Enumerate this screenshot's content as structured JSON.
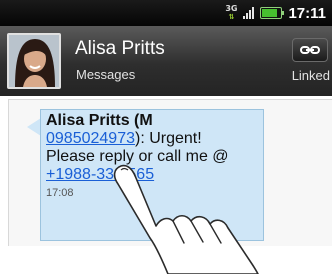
{
  "status_bar": {
    "network": "3G",
    "time": "17:11"
  },
  "header": {
    "contact_name": "Alisa Pritts",
    "subtitle": "Messages",
    "link_status": "Linked"
  },
  "message": {
    "sender_prefix": "Alisa Pritts (M",
    "sender_phone": "0985024973",
    "text_after_phone": "): Urgent!",
    "text_line3": "Please reply or call me @",
    "callback_number": "+1988-33 5565",
    "timestamp": "17:08"
  },
  "icons": [
    "network-3g-icon",
    "signal-strength-icon",
    "battery-icon",
    "link-icon",
    "pointing-hand-icon"
  ]
}
